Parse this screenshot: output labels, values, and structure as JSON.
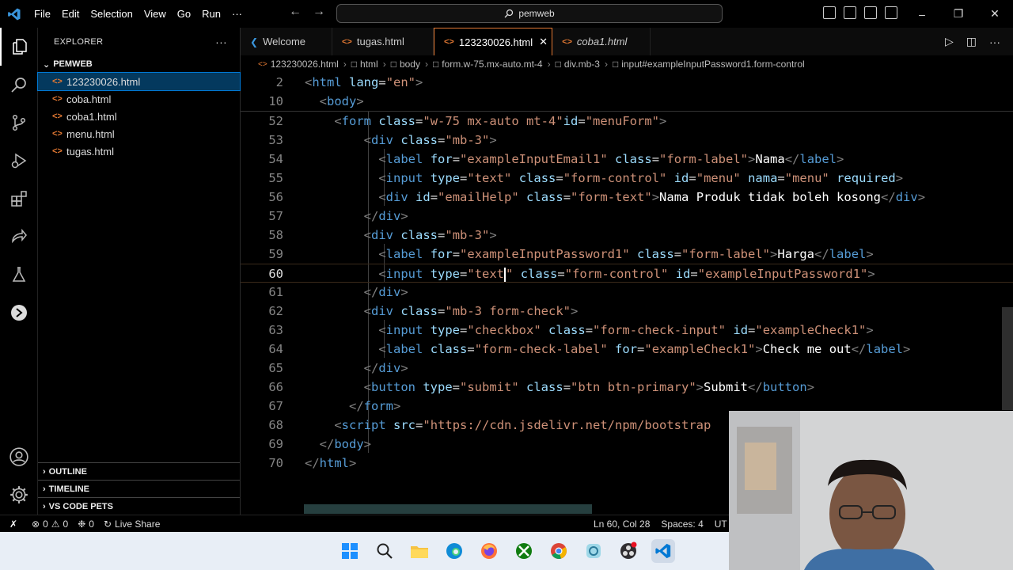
{
  "titlebar": {
    "menu": [
      "File",
      "Edit",
      "Selection",
      "View",
      "Go",
      "Run",
      "···"
    ],
    "search": "pemweb"
  },
  "sidebar": {
    "title": "EXPLORER",
    "root": "PEMWEB",
    "files": [
      "123230026.html",
      "coba.html",
      "coba1.html",
      "menu.html",
      "tugas.html"
    ],
    "selected_index": 0,
    "sections": [
      "OUTLINE",
      "TIMELINE",
      "VS CODE PETS"
    ]
  },
  "tabs": [
    {
      "label": "Welcome",
      "icon": "vscode-icon"
    },
    {
      "label": "tugas.html",
      "icon": "html-icon"
    },
    {
      "label": "123230026.html",
      "icon": "html-icon",
      "active": true
    },
    {
      "label": "coba1.html",
      "icon": "html-icon",
      "italic": true
    }
  ],
  "breadcrumb": [
    "123230026.html",
    "html",
    "body",
    "form.w-75.mx-auto.mt-4",
    "div.mb-3",
    "input#exampleInputPassword1.form-control"
  ],
  "editor": {
    "lines": [
      {
        "n": "2"
      },
      {
        "n": "10"
      },
      {
        "n": "52"
      },
      {
        "n": "53"
      },
      {
        "n": "54"
      },
      {
        "n": "55"
      },
      {
        "n": "56"
      },
      {
        "n": "57"
      },
      {
        "n": "58"
      },
      {
        "n": "59"
      },
      {
        "n": "60"
      },
      {
        "n": "61"
      },
      {
        "n": "62"
      },
      {
        "n": "63"
      },
      {
        "n": "64"
      },
      {
        "n": "65"
      },
      {
        "n": "66"
      },
      {
        "n": "67"
      },
      {
        "n": "68"
      },
      {
        "n": "69"
      },
      {
        "n": "70"
      }
    ],
    "current_line": "60"
  },
  "statusbar": {
    "errors": "0",
    "warnings": "0",
    "ports": "0",
    "liveshare": "Live Share",
    "position": "Ln 60, Col 28",
    "spaces": "Spaces: 4",
    "encoding": "UT"
  },
  "colors": {
    "accent": "#0078d4",
    "html_icon": "#e37933",
    "tag": "#569cd6",
    "attr": "#9cdcfe",
    "string": "#ce9178"
  }
}
